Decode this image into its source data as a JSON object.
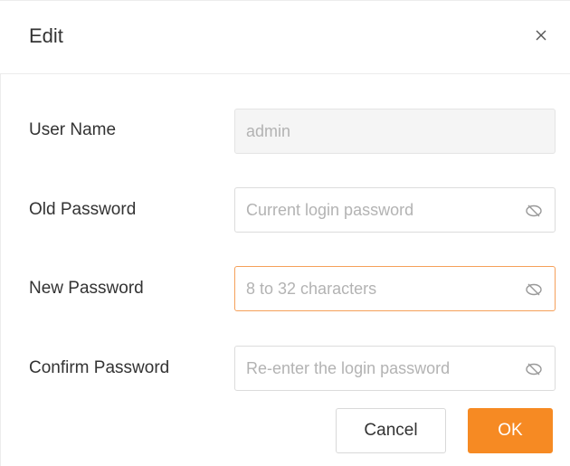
{
  "dialog": {
    "title": "Edit",
    "close_icon": "close-icon"
  },
  "form": {
    "user_name": {
      "label": "User Name",
      "value": "admin",
      "disabled": true
    },
    "old_password": {
      "label": "Old Password",
      "placeholder": "Current login password",
      "icon": "eye-off-icon"
    },
    "new_password": {
      "label": "New Password",
      "placeholder": "8 to 32 characters",
      "icon": "eye-off-icon",
      "focused": true
    },
    "confirm_password": {
      "label": "Confirm Password",
      "placeholder": "Re-enter the login password",
      "icon": "eye-off-icon"
    }
  },
  "buttons": {
    "cancel": "Cancel",
    "ok": "OK"
  },
  "colors": {
    "accent": "#f68a23",
    "focus_border": "#f5a05a"
  }
}
